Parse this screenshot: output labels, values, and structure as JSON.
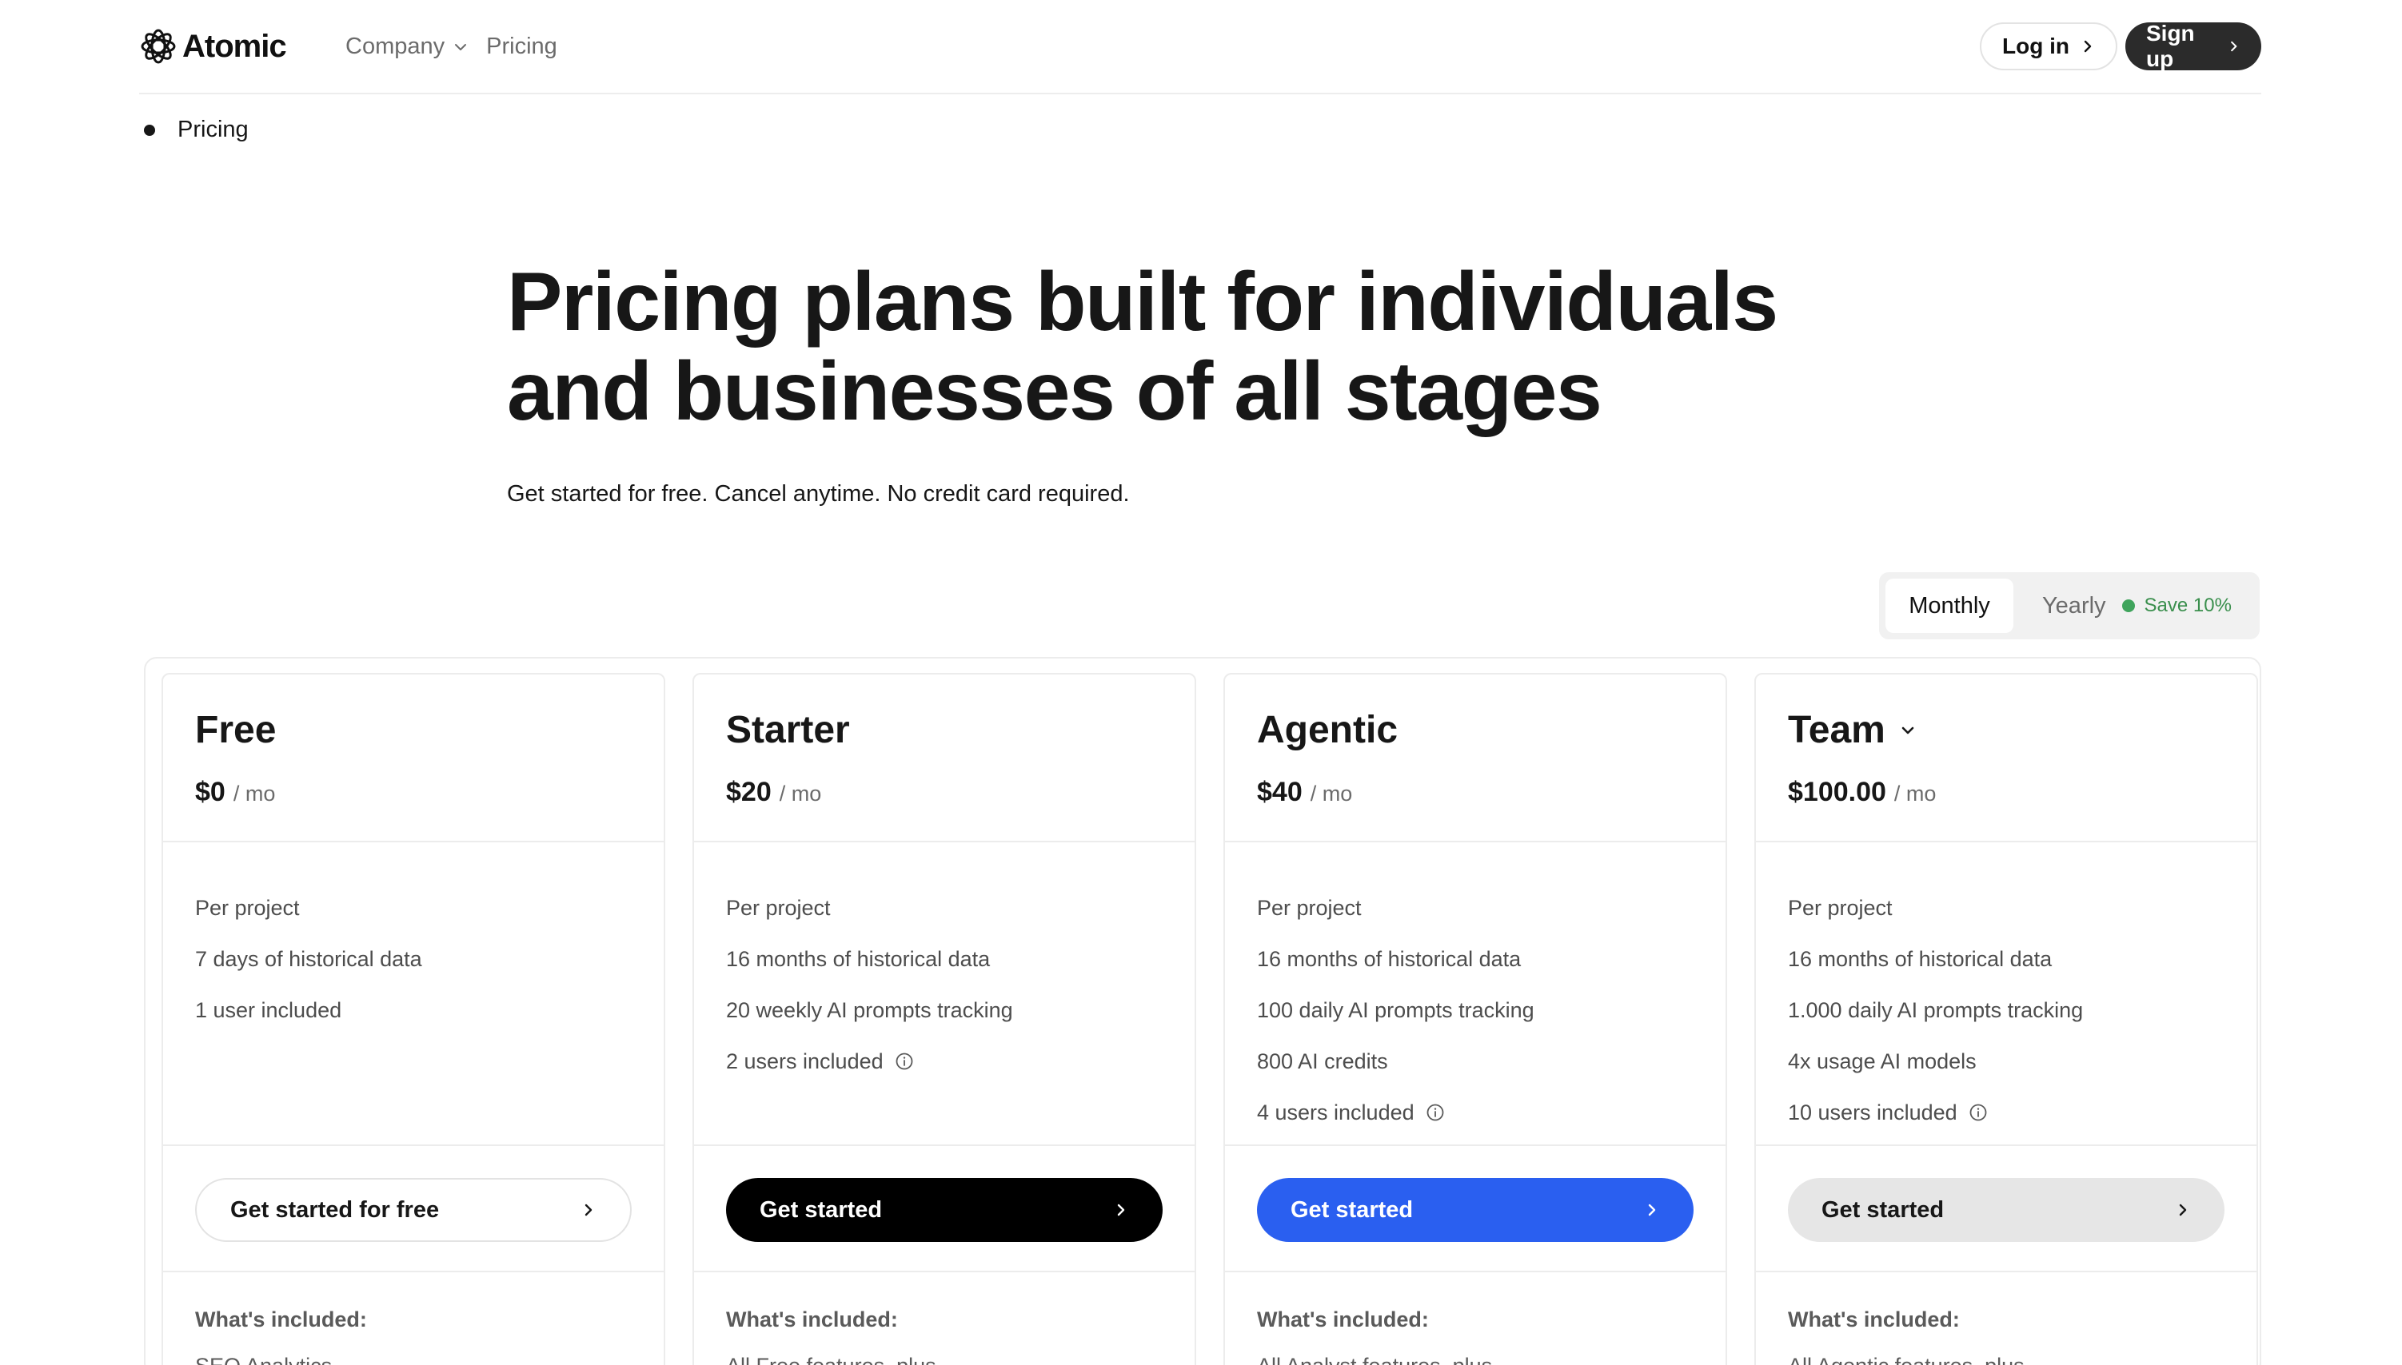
{
  "header": {
    "logo_text": "Atomic",
    "nav": [
      {
        "label": "Company",
        "has_dropdown": true
      },
      {
        "label": "Pricing",
        "has_dropdown": false
      }
    ],
    "login_label": "Log in",
    "signup_label": "Sign up"
  },
  "breadcrumb": {
    "label": "Pricing"
  },
  "hero": {
    "title_line1": "Pricing plans built for individuals",
    "title_line2": "and businesses of all stages",
    "subtitle": "Get started for free. Cancel anytime. No credit card required."
  },
  "billing": {
    "monthly_label": "Monthly",
    "yearly_label": "Yearly",
    "save_label": "Save 10%",
    "selected": "Monthly"
  },
  "plans": [
    {
      "name": "Free",
      "price": "$0",
      "per": "/ mo",
      "features": [
        "Per project",
        "7 days of historical data",
        "1 user included"
      ],
      "cta": "Get started for free",
      "included_title": "What's included:",
      "included_first": "SEO Analytics"
    },
    {
      "name": "Starter",
      "price": "$20",
      "per": "/ mo",
      "features": [
        "Per project",
        "16 months of historical data",
        "20 weekly AI prompts tracking",
        "2 users included"
      ],
      "cta": "Get started",
      "included_title": "What's included:",
      "included_first": "All Free features, plus"
    },
    {
      "name": "Agentic",
      "price": "$40",
      "per": "/ mo",
      "features": [
        "Per project",
        "16 months of historical data",
        "100 daily AI prompts tracking",
        "800 AI credits",
        "4 users included"
      ],
      "cta": "Get started",
      "included_title": "What's included:",
      "included_first": "All Analyst features, plus"
    },
    {
      "name": "Team",
      "price": "$100.00",
      "per": "/ mo",
      "features": [
        "Per project",
        "16 months of historical data",
        "1.000 daily AI prompts tracking",
        "4x usage AI models",
        "10 users included"
      ],
      "cta": "Get started",
      "included_title": "What's included:",
      "included_first": "All Agentic features, plus"
    }
  ],
  "colors": {
    "accent_blue": "#2a5ff0",
    "save_green": "#3fa45c",
    "signup_bg": "#2b2b2b"
  }
}
